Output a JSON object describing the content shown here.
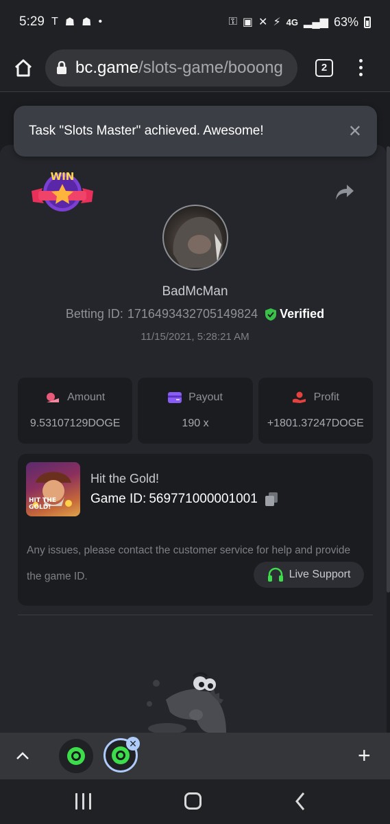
{
  "status_bar": {
    "time": "5:29",
    "network": "4G",
    "battery": "63%"
  },
  "browser": {
    "url_host": "bc.game",
    "url_path": "/slots-game/booong",
    "tab_count": "2"
  },
  "toast": {
    "message": "Task \"Slots Master\" achieved. Awesome!",
    "close_label": "✕"
  },
  "badge": {
    "text": "WIN"
  },
  "player": {
    "username": "BadMcMan",
    "betting_label": "Betting ID:",
    "betting_id": "1716493432705149824",
    "verified_label": "Verified",
    "timestamp": "11/15/2021, 5:28:21 AM"
  },
  "stats": [
    {
      "label": "Amount",
      "value": "9.53107129DOGE",
      "icon": "amount-icon",
      "color": "#e85a7a"
    },
    {
      "label": "Payout",
      "value": "190 x",
      "icon": "payout-icon",
      "color": "#8a5cf6"
    },
    {
      "label": "Profit",
      "value": "+1801.37247DOGE",
      "icon": "profit-icon",
      "color": "#e5413e"
    }
  ],
  "game": {
    "name": "Hit the Gold!",
    "id_label": "Game ID:",
    "id_value": "569771000001001",
    "thumb_text": "HIT THE GOLD!",
    "issue_text": "Any issues, please contact the customer service for help and provide the game ID.",
    "support_label": "Live Support"
  },
  "colors": {
    "verified": "#39c14a",
    "support_icon": "#3ddc4b",
    "favicon": "#3ddc4b"
  }
}
